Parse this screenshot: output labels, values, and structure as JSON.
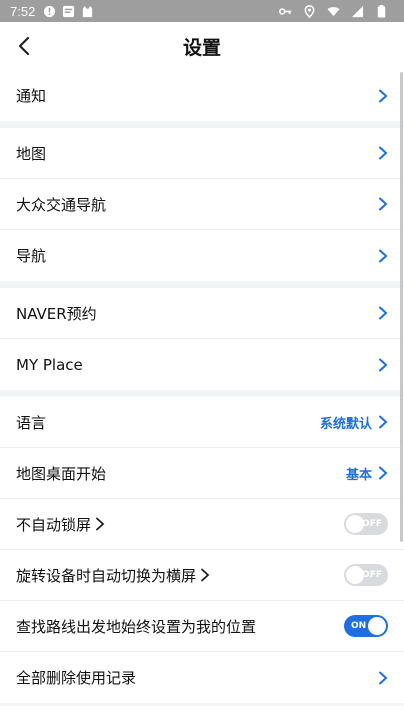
{
  "status": {
    "time": "7:52"
  },
  "header": {
    "title": "设置"
  },
  "groups": {
    "g1": {
      "notify": "通知"
    },
    "g2": {
      "map": "地图",
      "transit_nav": "大众交通导航",
      "nav": "导航"
    },
    "g3": {
      "naver_booking": "NAVER预约",
      "my_place": "MY Place"
    },
    "g4": {
      "language": "语言",
      "language_value": "系统默认",
      "map_start": "地图桌面开始",
      "map_start_value": "基本",
      "no_lock": "不自动锁屏",
      "no_lock_state": "OFF",
      "rotate": "旋转设备时自动切换为横屏",
      "rotate_state": "OFF",
      "start_location": "查找路线出发地始终设置为我的位置",
      "start_location_state": "ON",
      "delete_history": "全部删除使用记录"
    }
  },
  "colors": {
    "accent": "#1e6fe4",
    "toggle_off": "#d9dadd",
    "background": "#f2f3f5"
  }
}
